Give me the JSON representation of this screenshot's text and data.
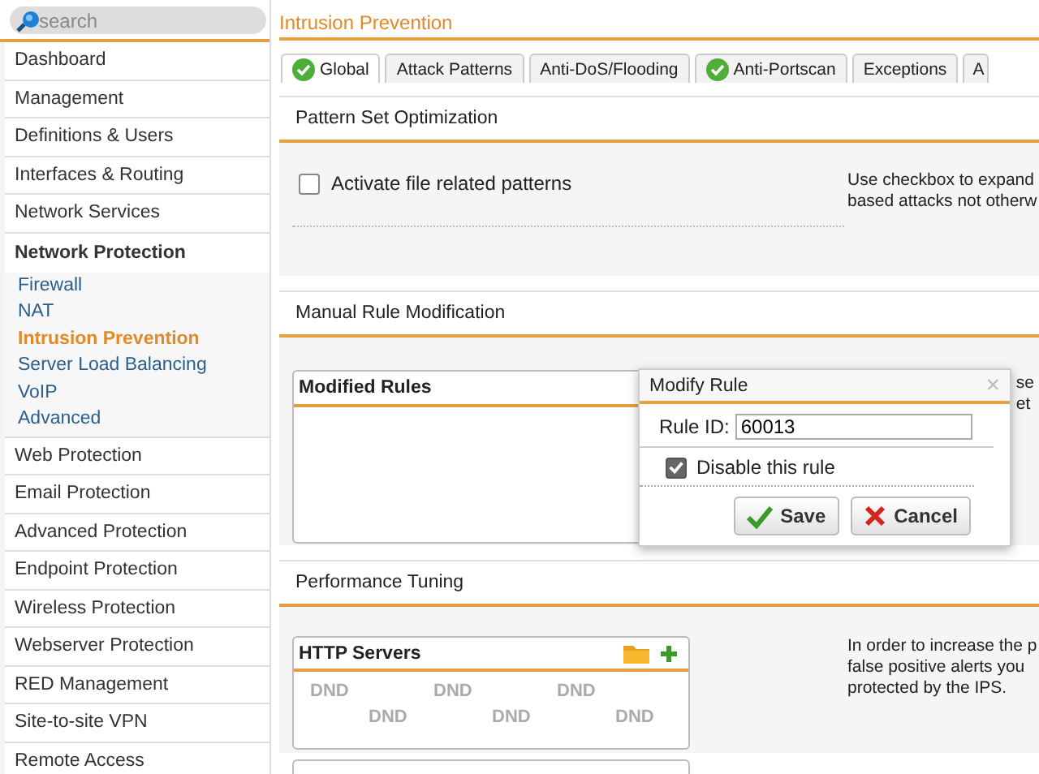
{
  "search": {
    "placeholder": "search"
  },
  "sidebar": {
    "items": [
      {
        "label": "Dashboard",
        "expanded": false
      },
      {
        "label": "Management",
        "expanded": false
      },
      {
        "label": "Definitions & Users",
        "expanded": false
      },
      {
        "label": "Interfaces & Routing",
        "expanded": false
      },
      {
        "label": "Network Services",
        "expanded": false
      },
      {
        "label": "Network Protection",
        "expanded": true,
        "children": [
          {
            "label": "Firewall",
            "selected": false
          },
          {
            "label": "NAT",
            "selected": false
          },
          {
            "label": "Intrusion Prevention",
            "selected": true
          },
          {
            "label": "Server Load Balancing",
            "selected": false
          },
          {
            "label": "VoIP",
            "selected": false
          },
          {
            "label": "Advanced",
            "selected": false
          }
        ]
      },
      {
        "label": "Web Protection",
        "expanded": false
      },
      {
        "label": "Email Protection",
        "expanded": false
      },
      {
        "label": "Advanced Protection",
        "expanded": false
      },
      {
        "label": "Endpoint Protection",
        "expanded": false
      },
      {
        "label": "Wireless Protection",
        "expanded": false
      },
      {
        "label": "Webserver Protection",
        "expanded": false
      },
      {
        "label": "RED Management",
        "expanded": false
      },
      {
        "label": "Site-to-site VPN",
        "expanded": false
      },
      {
        "label": "Remote Access",
        "expanded": false
      }
    ]
  },
  "page_title": "Intrusion Prevention",
  "tabs": [
    {
      "label": "Global",
      "selected": true,
      "enabled": true
    },
    {
      "label": "Attack Patterns",
      "selected": false,
      "enabled": false
    },
    {
      "label": "Anti-DoS/Flooding",
      "selected": false,
      "enabled": false
    },
    {
      "label": "Anti-Portscan",
      "selected": false,
      "enabled": true
    },
    {
      "label": "Exceptions",
      "selected": false,
      "enabled": false
    },
    {
      "label": "A",
      "selected": false,
      "enabled": false
    }
  ],
  "pattern_set": {
    "title": "Pattern Set Optimization",
    "checkbox": {
      "label": "Activate file related patterns",
      "checked": false
    },
    "help": [
      "Use checkbox to expand",
      "based attacks not otherw"
    ]
  },
  "manual_rule": {
    "title": "Manual Rule Modification",
    "list_title": "Modified Rules",
    "help": [
      "se",
      "et"
    ]
  },
  "dialog": {
    "title": "Modify Rule",
    "close": "×",
    "field_label": "Rule ID:",
    "field_value": "60013",
    "checkbox": {
      "label": "Disable this rule",
      "checked": true
    },
    "buttons": [
      {
        "kind": "save",
        "label": "Save"
      },
      {
        "kind": "cancel",
        "label": "Cancel"
      }
    ]
  },
  "performance": {
    "title": "Performance Tuning",
    "list_title": "HTTP Servers",
    "hints": [
      "DND",
      "DND",
      "DND",
      "DND",
      "DND",
      "DND"
    ],
    "help": [
      "In order to increase the p",
      "false positive alerts you",
      "protected by the IPS."
    ]
  }
}
